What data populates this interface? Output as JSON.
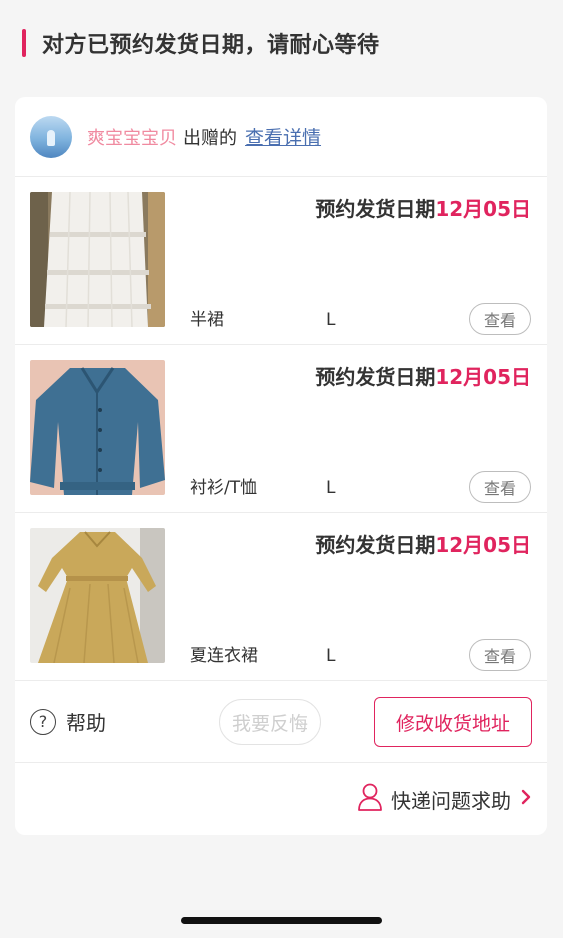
{
  "header": {
    "title": "对方已预约发货日期，请耐心等待"
  },
  "giver": {
    "name": "爽宝宝宝贝",
    "verb": "出赠的",
    "detail_link": "查看详情"
  },
  "items": [
    {
      "ship_prefix": "预约发货日期",
      "ship_date": "12月05日",
      "category": "半裙",
      "size": "L",
      "view_label": "查看"
    },
    {
      "ship_prefix": "预约发货日期",
      "ship_date": "12月05日",
      "category": "衬衫/T恤",
      "size": "L",
      "view_label": "查看"
    },
    {
      "ship_prefix": "预约发货日期",
      "ship_date": "12月05日",
      "category": "夏连衣裙",
      "size": "L",
      "view_label": "查看"
    }
  ],
  "actions": {
    "help_label": "帮助",
    "regret_label": "我要反悔",
    "modify_label": "修改收货地址"
  },
  "express": {
    "label": "快递问题求助"
  },
  "colors": {
    "accent": "#e0245e",
    "link": "#4a6fb0",
    "giver_name": "#f08aa0"
  }
}
